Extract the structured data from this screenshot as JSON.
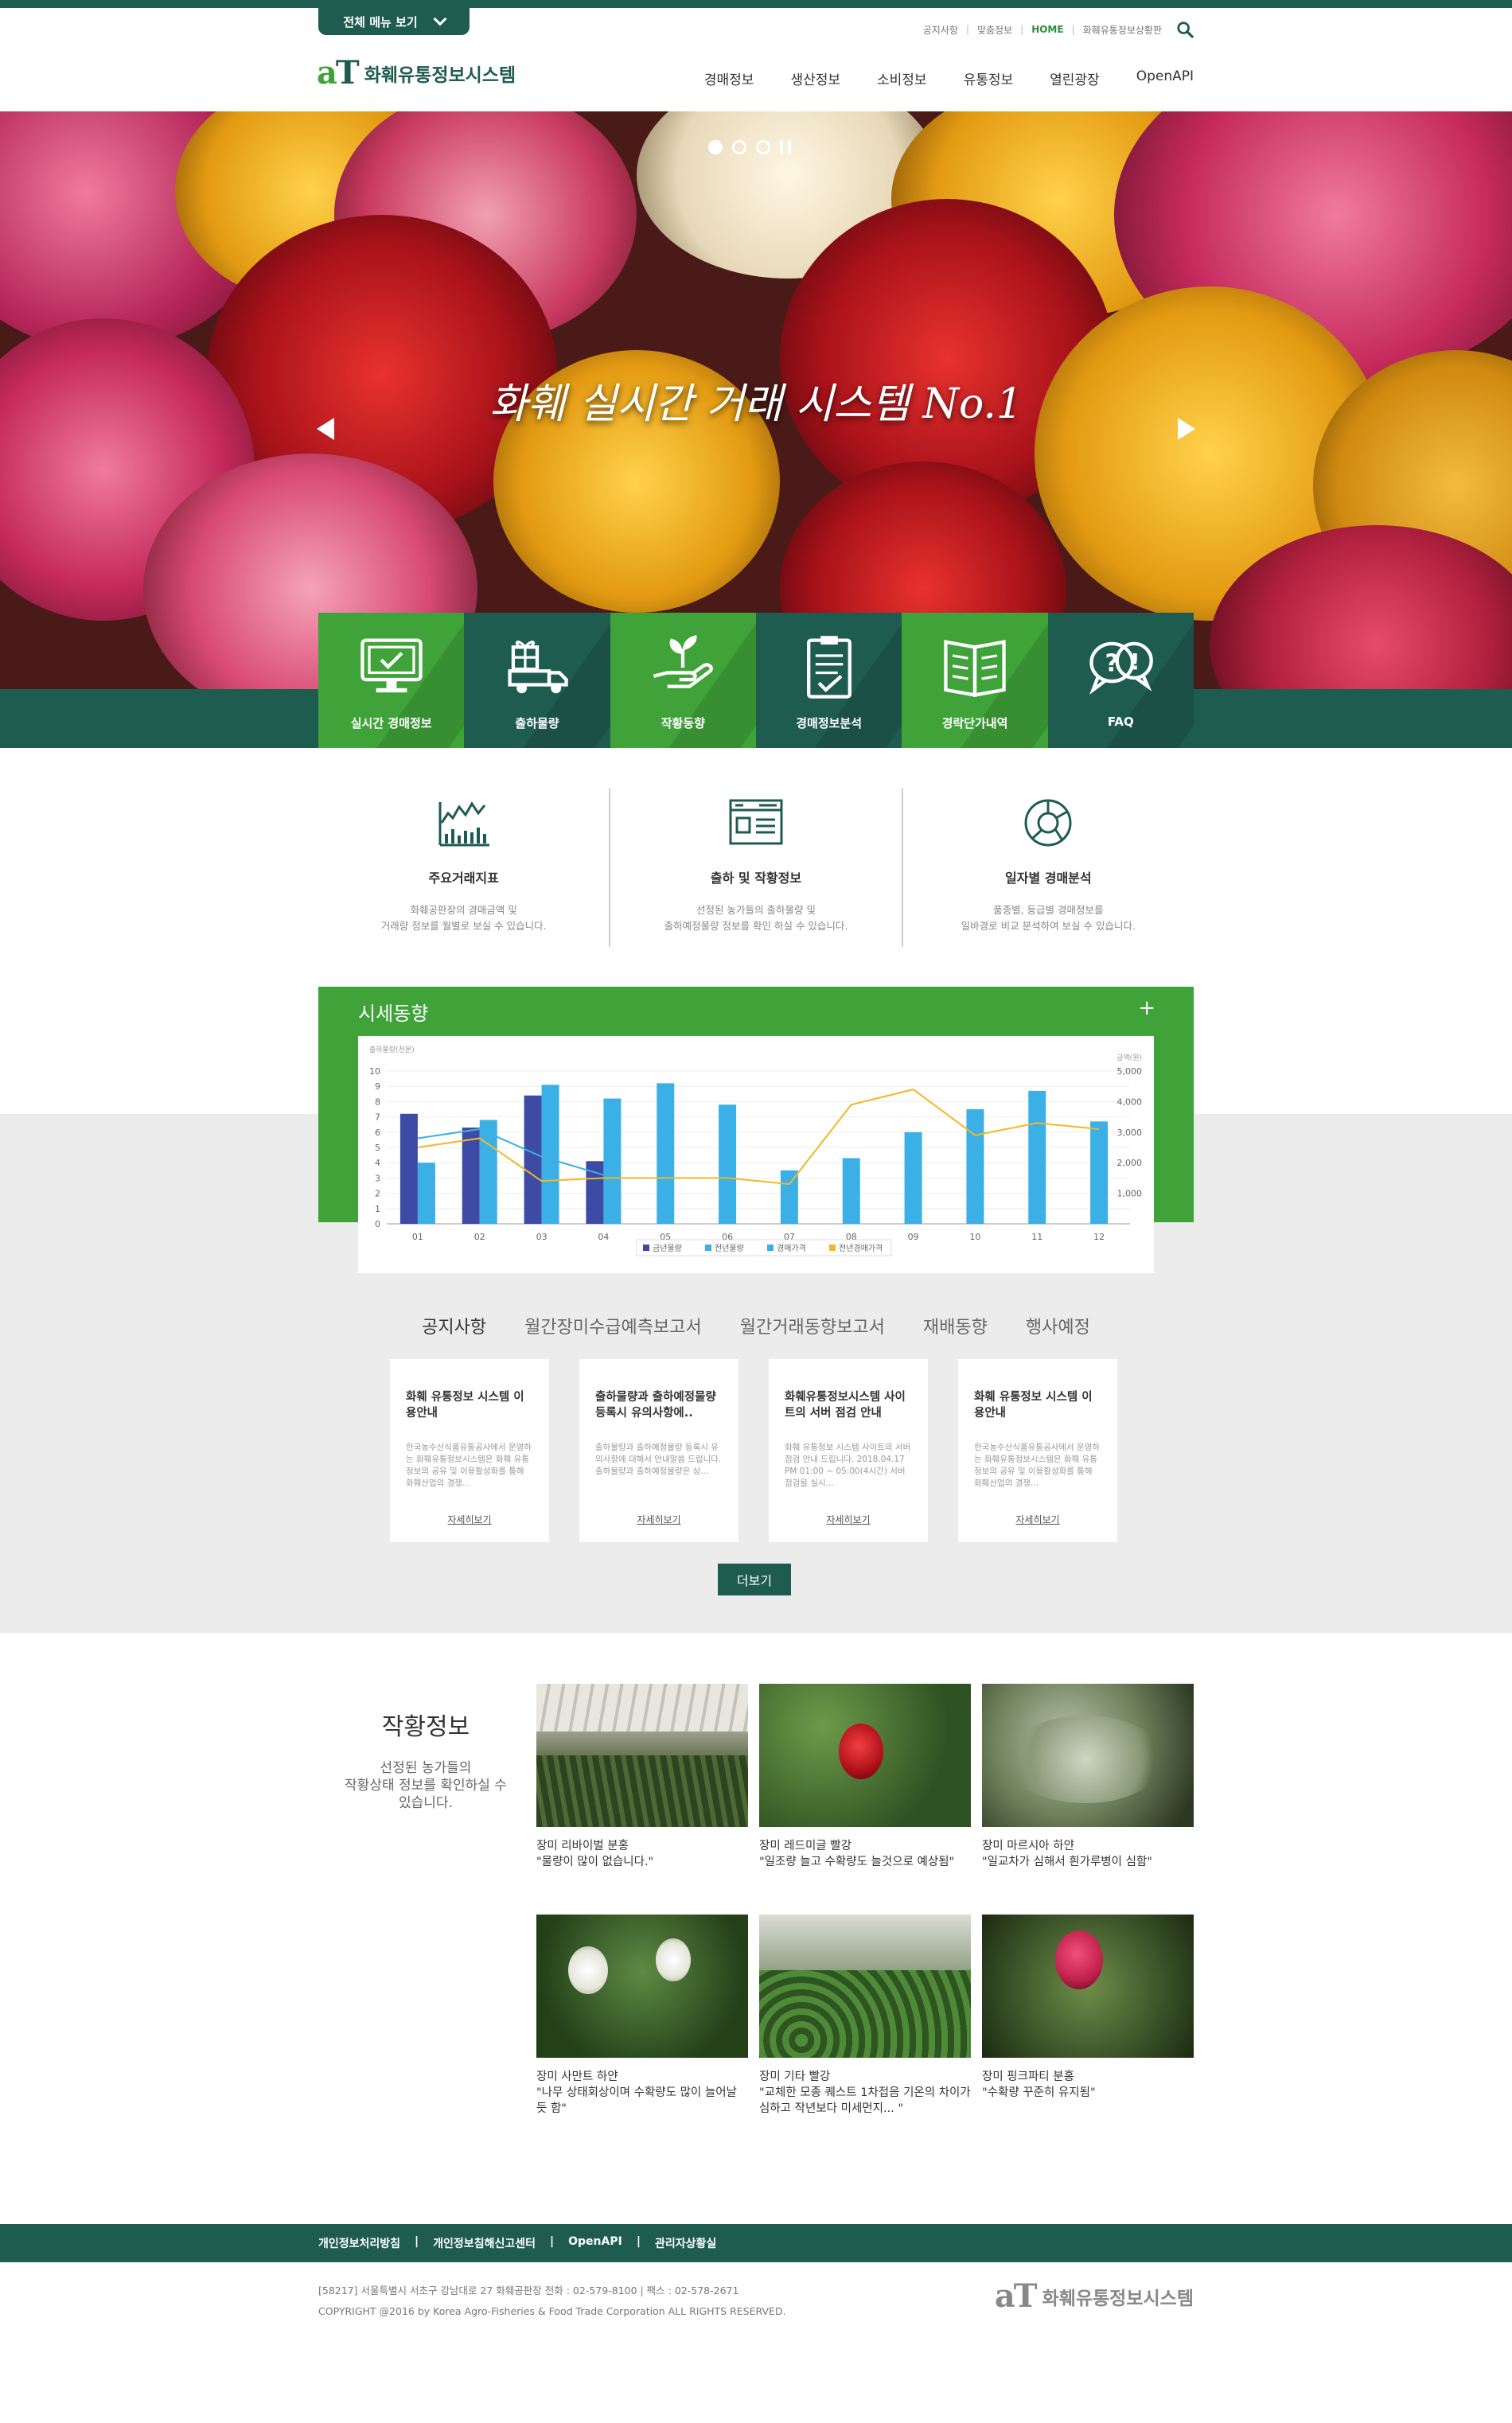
{
  "header": {
    "all_menu_label": "전체 메뉴 보기",
    "util_links": [
      "공지사항",
      "맞춤정보",
      "HOME",
      "화훼유통정보상황판"
    ],
    "logo_mark": "aT",
    "logo_name": "화훼유통정보시스템",
    "nav": [
      "경매정보",
      "생산정보",
      "소비정보",
      "유통정보",
      "열린광장",
      "OpenAPI"
    ]
  },
  "hero": {
    "title": "화훼 실시간 거래 시스템 No.1",
    "slides": 3,
    "active_slide": 1
  },
  "quick_menu": [
    {
      "label": "실시간 경매정보",
      "icon": "monitor-check-icon",
      "tone": "green"
    },
    {
      "label": "출하물량",
      "icon": "truck-gift-icon",
      "tone": "dark"
    },
    {
      "label": "작황동향",
      "icon": "sprout-hand-icon",
      "tone": "green"
    },
    {
      "label": "경매정보분석",
      "icon": "clipboard-check-icon",
      "tone": "dark"
    },
    {
      "label": "경락단가내역",
      "icon": "open-book-icon",
      "tone": "green"
    },
    {
      "label": "FAQ",
      "icon": "question-bubble-icon",
      "tone": "dark"
    }
  ],
  "features": [
    {
      "title": "주요거래지표",
      "desc1": "화훼공판장의 경매금액 및",
      "desc2": "거래량 정보를 월별로 보실 수 있습니다.",
      "icon": "bar-chart-icon"
    },
    {
      "title": "출하 및 작황정보",
      "desc1": "선정된 농가들의 출하물량 및",
      "desc2": "출하예정물량 정보를 확인 하실 수 있습니다.",
      "icon": "browser-list-icon"
    },
    {
      "title": "일자별 경매분석",
      "desc1": "품종별, 등급별 경매정보를",
      "desc2": "일바경로 비교 분석하여 보실 수 있습니다.",
      "icon": "pie-analysis-icon"
    }
  ],
  "trend": {
    "title": "시세동향",
    "plus": "+"
  },
  "chart_data": {
    "type": "bar",
    "ylabel_left": "출하물량(천본)",
    "ylabel_right": "금액(원)",
    "categories": [
      "01",
      "02",
      "03",
      "04",
      "05",
      "06",
      "07",
      "08",
      "09",
      "10",
      "11",
      "12"
    ],
    "ylim": [
      0,
      10
    ],
    "yticks_left": [
      "0",
      "1",
      "2",
      "3",
      "4",
      "5",
      "6",
      "7",
      "8",
      "9",
      "10"
    ],
    "ylim_right": [
      0,
      5000
    ],
    "yticks_right": [
      "1,000",
      "2,000",
      "3,000",
      "4,000",
      "5,000"
    ],
    "series": [
      {
        "name": "금년물량",
        "kind": "bar",
        "color": "#3d4aa6",
        "values": [
          7.2,
          6.3,
          8.4,
          4.1,
          null,
          null,
          null,
          null,
          null,
          null,
          null,
          null
        ]
      },
      {
        "name": "전년물량",
        "kind": "bar",
        "color": "#3ab0e6",
        "values": [
          4.0,
          6.8,
          9.1,
          8.2,
          9.2,
          7.8,
          3.5,
          4.3,
          6.0,
          7.5,
          8.7,
          6.7
        ]
      },
      {
        "name": "경매가격",
        "kind": "line",
        "color": "#3ab0e6",
        "values": [
          2800,
          3100,
          2200,
          1600,
          null,
          null,
          null,
          null,
          null,
          null,
          null,
          null
        ]
      },
      {
        "name": "전년경매가격",
        "kind": "line",
        "color": "#f2b824",
        "values": [
          2500,
          2800,
          1400,
          1500,
          1500,
          1500,
          1300,
          3900,
          4400,
          2900,
          3300,
          3100
        ]
      }
    ],
    "legend_position": "bottom"
  },
  "notice_tabs": [
    "공지사항",
    "월간장미수급예측보고서",
    "월간거래동향보고서",
    "재배동향",
    "행사예정"
  ],
  "notice_cards": [
    {
      "title": "화훼 유통정보 시스템 이용안내",
      "body": "한국농수산식품유통공사에서 운영하는 화훼유통정보시스템은 화훼 유통정보의 공유 및 이용활성화를 통해 화훼산업의 경쟁...",
      "link": "자세히보기"
    },
    {
      "title": "출하물량과 출하예정물량 등록시 유의사항에..",
      "body": "출하물량과 출하예정물량 등록시 유의사항에 대해서 안내말씀 드립니다. 출하물량과 출하예정물량은 상...",
      "link": "자세히보기"
    },
    {
      "title": "화훼유통정보시스템 사이트의 서버 점검 안내",
      "body": "화훼 유통정보 시스템 사이트의 서버 점검 안내 드립니다. 2018.04.17 PM 01:00 ~ 05:00(4시간) 서버 점검을 실시...",
      "link": "자세히보기"
    },
    {
      "title": "화훼 유통정보 시스템 이용안내",
      "body": "한국농수산식품유통공사에서 운영하는 화훼유통정보시스템은 화훼 유통정보의 공유 및 이용활성화를 통해 화훼산업의 경쟁...",
      "link": "자세히보기"
    }
  ],
  "more_label": "더보기",
  "crop": {
    "title": "작황정보",
    "desc": [
      "선정된 농가들의",
      "작황상태 정보를 확인하실 수",
      "있습니다."
    ],
    "items": [
      {
        "line1": "장미 리바이벌 분홍",
        "line2": "\"물량이 많이 없습니다.\"",
        "scene": "greenhouse"
      },
      {
        "line1": "장미 레드미글 빨강",
        "line2": "\"일조량 늘고 수확량도 늘것으로 예상됨\"",
        "scene": "redrose"
      },
      {
        "line1": "장미 마르시아 하얀",
        "line2": "\"일교차가 심해서 흰가루병이 심함\"",
        "scene": "leaves"
      },
      {
        "line1": "장미 사만트 하얀",
        "line2": "\"나무 상태회상이며 수확량도 많이 늘어날 듯 함\"",
        "scene": "whiterose"
      },
      {
        "line1": "장미 기타 빨강",
        "line2": "\"교체한 모종 퀘스트 1차접음 기온의 차이가 심하고 작년보다 미세먼지... \"",
        "scene": "seedlings"
      },
      {
        "line1": "장미 핑크파티 분홍",
        "line2": "\"수확량 꾸준히 유지됨\"",
        "scene": "pinkrose"
      }
    ]
  },
  "footer": {
    "links": [
      "개인정보처리방침",
      "개인정보침해신고센터",
      "OpenAPI",
      "관리자상황실"
    ],
    "address": "[58217] 서울특별시 서초구 강남대로 27 화훼공판장 전화 : 02-579-8100  |  팩스 : 02-578-2671",
    "copyright": "COPYRIGHT @2016 by Korea Agro-Fisheries & Food Trade Corporation ALL RIGHTS RESERVED.",
    "logo_mark": "aT",
    "logo_name": "화훼유통정보시스템"
  }
}
